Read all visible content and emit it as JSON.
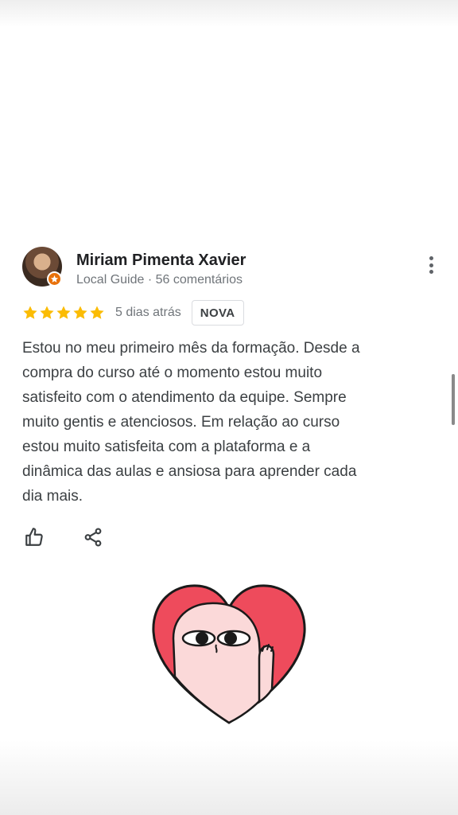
{
  "review": {
    "reviewer_name": "Miriam Pimenta Xavier",
    "reviewer_meta": "Local Guide · 56 comentários",
    "rating": 5,
    "rating_max": 5,
    "date": "5 dias atrás",
    "badge": "NOVA",
    "text": "Estou no meu primeiro mês da formação. Desde a\ncompra do curso até o momento estou muito\nsatisfeito com o atendimento da equipe. Sempre\nmuito gentis e atenciosos. Em relação ao curso\nestou muito satisfeita com a plataforma e a\ndinâmica das aulas e ansiosa para aprender cada\ndia mais."
  },
  "icons": {
    "avatar_badge": "local-guide-star-badge",
    "more": "more-vertical-icon",
    "like": "thumbs-up-icon",
    "share": "share-icon",
    "sticker": "heart-character-sticker"
  },
  "colors": {
    "star": "#fbbc04",
    "name": "#202124",
    "secondary_text": "#70757a",
    "body_text": "#3c4043",
    "badge_orange": "#e8710a",
    "sticker_red": "#ee4b5c",
    "sticker_pink": "#fbd9d9"
  }
}
